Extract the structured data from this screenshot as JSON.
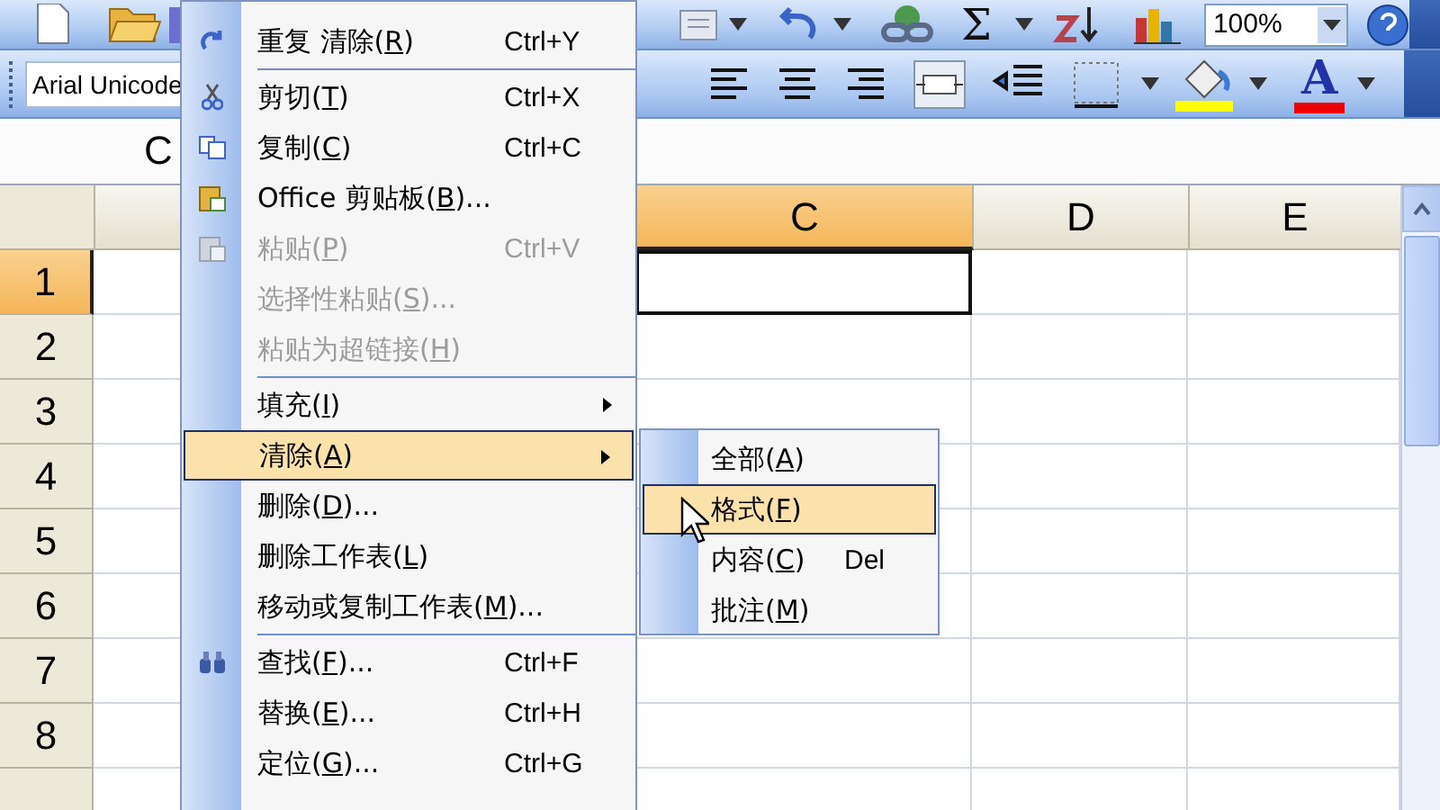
{
  "toolbar_standard": {
    "autosum": "Σ",
    "zoom": "100%"
  },
  "toolbar_formatting": {
    "font": "Arial Unicode",
    "font_color": "A"
  },
  "name_box": "C",
  "columns": [
    {
      "label": "C",
      "selected": true
    },
    {
      "label": "D",
      "selected": false
    },
    {
      "label": "E",
      "selected": false
    }
  ],
  "rows": [
    {
      "label": "1",
      "selected": true
    },
    {
      "label": "2",
      "selected": false
    },
    {
      "label": "3",
      "selected": false
    },
    {
      "label": "4",
      "selected": false
    },
    {
      "label": "5",
      "selected": false
    },
    {
      "label": "6",
      "selected": false
    },
    {
      "label": "7",
      "selected": false
    },
    {
      "label": "8",
      "selected": false
    }
  ],
  "edit_menu": [
    {
      "kind": "item",
      "pre": "重复 清除(",
      "key": "R",
      "post": ")",
      "shortcut": "Ctrl+Y",
      "disabled": false,
      "submenu": false,
      "selected": false
    },
    {
      "kind": "separator"
    },
    {
      "kind": "item",
      "pre": "剪切(",
      "key": "T",
      "post": ")",
      "shortcut": "Ctrl+X",
      "disabled": false,
      "submenu": false,
      "selected": false
    },
    {
      "kind": "item",
      "pre": "复制(",
      "key": "C",
      "post": ")",
      "shortcut": "Ctrl+C",
      "disabled": false,
      "submenu": false,
      "selected": false
    },
    {
      "kind": "item",
      "pre": "Office 剪贴板(",
      "key": "B",
      "post": ")...",
      "disabled": false,
      "submenu": false,
      "selected": false
    },
    {
      "kind": "item",
      "pre": "粘贴(",
      "key": "P",
      "post": ")",
      "shortcut": "Ctrl+V",
      "disabled": true,
      "submenu": false,
      "selected": false
    },
    {
      "kind": "item",
      "pre": "选择性粘贴(",
      "key": "S",
      "post": ")...",
      "disabled": true,
      "submenu": false,
      "selected": false
    },
    {
      "kind": "item",
      "pre": "粘贴为超链接(",
      "key": "H",
      "post": ")",
      "disabled": true,
      "submenu": false,
      "selected": false
    },
    {
      "kind": "separator"
    },
    {
      "kind": "item",
      "pre": "填充(",
      "key": "I",
      "post": ")",
      "disabled": false,
      "submenu": true,
      "selected": false
    },
    {
      "kind": "item",
      "pre": "清除(",
      "key": "A",
      "post": ")",
      "disabled": false,
      "submenu": true,
      "selected": true
    },
    {
      "kind": "item",
      "pre": "删除(",
      "key": "D",
      "post": ")...",
      "disabled": false,
      "submenu": false,
      "selected": false
    },
    {
      "kind": "item",
      "pre": "删除工作表(",
      "key": "L",
      "post": ")",
      "disabled": false,
      "submenu": false,
      "selected": false
    },
    {
      "kind": "item",
      "pre": "移动或复制工作表(",
      "key": "M",
      "post": ")...",
      "disabled": false,
      "submenu": false,
      "selected": false
    },
    {
      "kind": "separator"
    },
    {
      "kind": "item",
      "pre": "查找(",
      "key": "F",
      "post": ")...",
      "shortcut": "Ctrl+F",
      "disabled": false,
      "submenu": false,
      "selected": false
    },
    {
      "kind": "item",
      "pre": "替换(",
      "key": "E",
      "post": ")...",
      "shortcut": "Ctrl+H",
      "disabled": false,
      "submenu": false,
      "selected": false
    },
    {
      "kind": "item",
      "pre": "定位(",
      "key": "G",
      "post": ")...",
      "shortcut": "Ctrl+G",
      "disabled": false,
      "submenu": false,
      "selected": false
    }
  ],
  "clear_submenu": [
    {
      "pre": "全部(",
      "key": "A",
      "post": ")",
      "selected": false
    },
    {
      "pre": "格式(",
      "key": "F",
      "post": ")",
      "selected": true
    },
    {
      "pre": "内容(",
      "key": "C",
      "post": ")",
      "shortcut": "Del",
      "selected": false
    },
    {
      "pre": "批注(",
      "key": "M",
      "post": ")",
      "selected": false
    }
  ]
}
